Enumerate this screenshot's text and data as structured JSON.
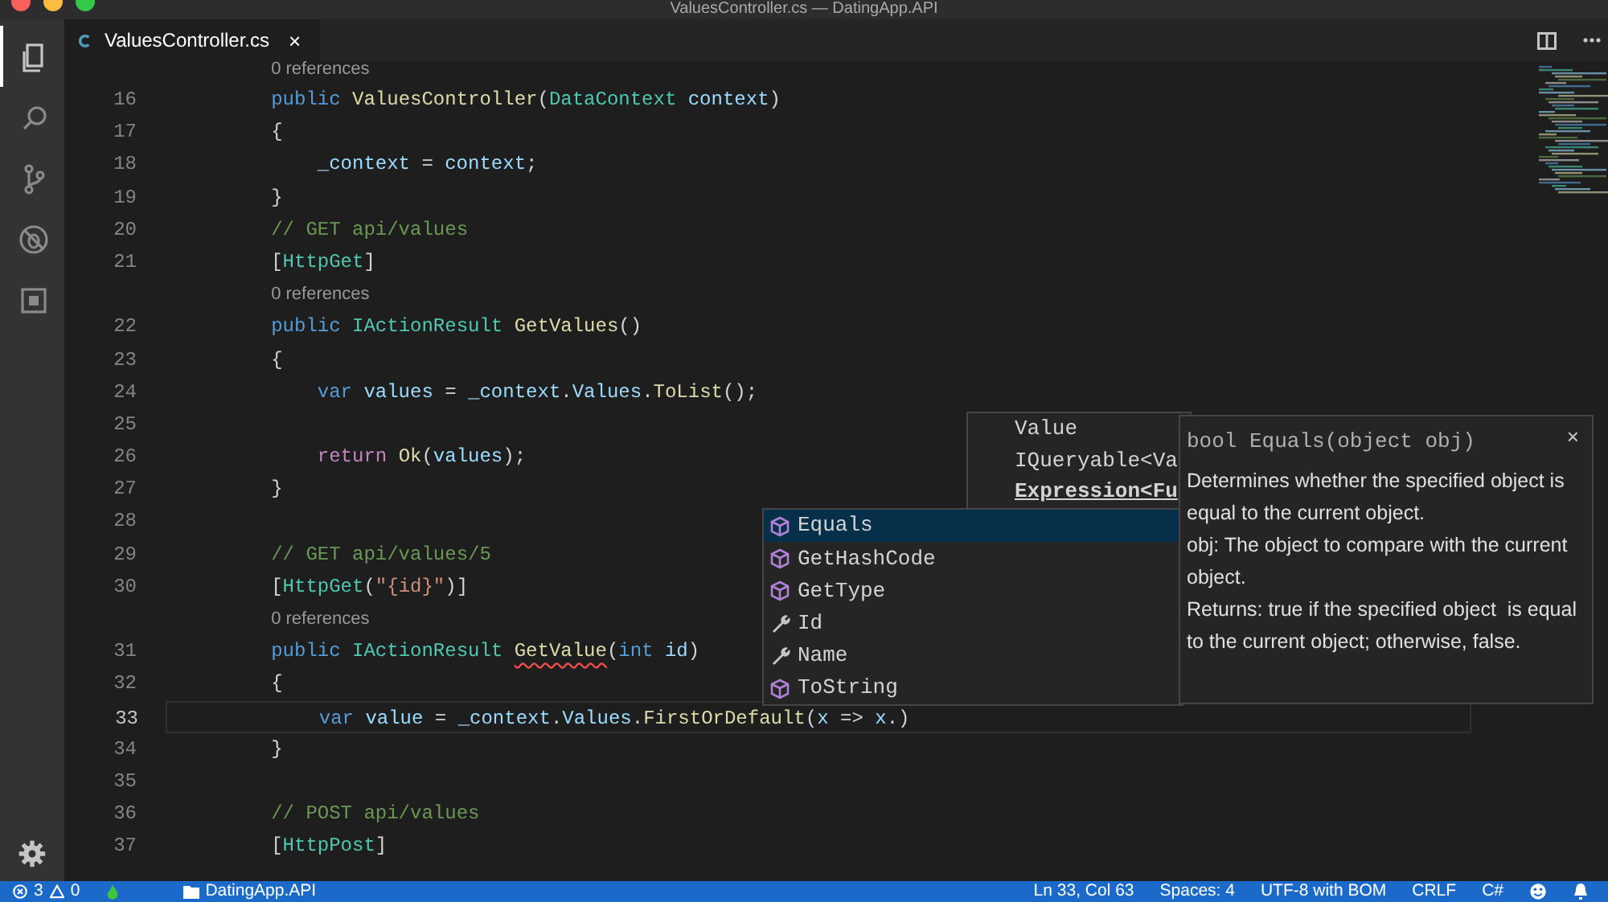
{
  "window": {
    "title": "ValuesController.cs — DatingApp.API"
  },
  "tabs": [
    {
      "label": "ValuesController.cs",
      "close": "×",
      "selected": true
    }
  ],
  "activity_bar": [
    {
      "kind": "files",
      "selected": true
    },
    {
      "kind": "search",
      "selected": false
    },
    {
      "kind": "scm",
      "selected": false
    },
    {
      "kind": "debug",
      "selected": false
    },
    {
      "kind": "extensions",
      "selected": false
    }
  ],
  "editor": {
    "lines": [
      {
        "kind": "lens",
        "text": "0 references"
      },
      {
        "kind": "code",
        "number": "16",
        "current": false,
        "indented": false,
        "tokens": [
          {
            "text": "public ",
            "kind": "kw"
          },
          {
            "text": "ValuesController",
            "kind": "fn"
          },
          {
            "text": "(",
            "kind": "plain"
          },
          {
            "text": "DataContext ",
            "kind": "type"
          },
          {
            "text": "context",
            "kind": "var"
          },
          {
            "text": ")",
            "kind": "plain"
          }
        ]
      },
      {
        "kind": "code",
        "number": "17",
        "current": false,
        "indented": false,
        "tokens": [
          {
            "text": "{",
            "kind": "plain"
          }
        ]
      },
      {
        "kind": "code",
        "number": "18",
        "current": false,
        "indented": true,
        "tokens": [
          {
            "text": "_context",
            "kind": "var"
          },
          {
            "text": " = ",
            "kind": "plain"
          },
          {
            "text": "context",
            "kind": "var"
          },
          {
            "text": ";",
            "kind": "plain"
          }
        ]
      },
      {
        "kind": "code",
        "number": "19",
        "current": false,
        "indented": false,
        "tokens": [
          {
            "text": "}",
            "kind": "plain"
          }
        ]
      },
      {
        "kind": "code",
        "number": "20",
        "current": false,
        "indented": false,
        "tokens": [
          {
            "text": "// GET api/values",
            "kind": "comment"
          }
        ]
      },
      {
        "kind": "code",
        "number": "21",
        "current": false,
        "indented": false,
        "tokens": [
          {
            "text": "[",
            "kind": "plain"
          },
          {
            "text": "HttpGet",
            "kind": "type"
          },
          {
            "text": "]",
            "kind": "plain"
          }
        ]
      },
      {
        "kind": "lens",
        "text": "0 references"
      },
      {
        "kind": "code",
        "number": "22",
        "current": false,
        "indented": false,
        "tokens": [
          {
            "text": "public ",
            "kind": "kw"
          },
          {
            "text": "IActionResult ",
            "kind": "type"
          },
          {
            "text": "GetValues",
            "kind": "fn"
          },
          {
            "text": "()",
            "kind": "plain"
          }
        ]
      },
      {
        "kind": "code",
        "number": "23",
        "current": false,
        "indented": false,
        "tokens": [
          {
            "text": "{",
            "kind": "plain"
          }
        ]
      },
      {
        "kind": "code",
        "number": "24",
        "current": false,
        "indented": true,
        "tokens": [
          {
            "text": "var ",
            "kind": "kw"
          },
          {
            "text": "values",
            "kind": "var"
          },
          {
            "text": " = ",
            "kind": "plain"
          },
          {
            "text": "_context",
            "kind": "var"
          },
          {
            "text": ".",
            "kind": "plain"
          },
          {
            "text": "Values",
            "kind": "var"
          },
          {
            "text": ".",
            "kind": "plain"
          },
          {
            "text": "ToList",
            "kind": "fn"
          },
          {
            "text": "();",
            "kind": "plain"
          }
        ]
      },
      {
        "kind": "code",
        "number": "25",
        "current": false
      },
      {
        "kind": "code",
        "number": "26",
        "current": false,
        "indented": true,
        "tokens": [
          {
            "text": "return ",
            "kind": "ctrl"
          },
          {
            "text": "Ok",
            "kind": "fn"
          },
          {
            "text": "(",
            "kind": "plain"
          },
          {
            "text": "values",
            "kind": "var"
          },
          {
            "text": ");",
            "kind": "plain"
          }
        ]
      },
      {
        "kind": "code",
        "number": "27",
        "current": false,
        "indented": false,
        "tokens": [
          {
            "text": "}",
            "kind": "plain"
          }
        ]
      },
      {
        "kind": "code",
        "number": "28",
        "current": false
      },
      {
        "kind": "code",
        "number": "29",
        "current": false,
        "indented": false,
        "tokens": [
          {
            "text": "// GET api/values/5",
            "kind": "comment"
          }
        ]
      },
      {
        "kind": "code",
        "number": "30",
        "current": false,
        "indented": false,
        "tokens": [
          {
            "text": "[",
            "kind": "plain"
          },
          {
            "text": "HttpGet",
            "kind": "type"
          },
          {
            "text": "(",
            "kind": "plain"
          },
          {
            "text": "\"{id}\"",
            "kind": "str"
          },
          {
            "text": ")]",
            "kind": "plain"
          }
        ]
      },
      {
        "kind": "lens",
        "text": "0 references"
      },
      {
        "kind": "code",
        "number": "31",
        "current": false,
        "indented": false,
        "tokens": [
          {
            "text": "public ",
            "kind": "kw"
          },
          {
            "text": "IActionResult ",
            "kind": "type"
          },
          {
            "text": "GetValue",
            "kind": "fn",
            "error": true
          },
          {
            "text": "(",
            "kind": "plain"
          },
          {
            "text": "int ",
            "kind": "kw"
          },
          {
            "text": "id",
            "kind": "var"
          },
          {
            "text": ")",
            "kind": "plain"
          }
        ]
      },
      {
        "kind": "code",
        "number": "32",
        "current": false,
        "indented": false,
        "tokens": [
          {
            "text": "{",
            "kind": "plain"
          }
        ]
      },
      {
        "kind": "code",
        "number": "33",
        "current": true,
        "indented": true,
        "tokens": [
          {
            "text": "var ",
            "kind": "kw"
          },
          {
            "text": "value",
            "kind": "var"
          },
          {
            "text": " = ",
            "kind": "plain"
          },
          {
            "text": "_context",
            "kind": "var"
          },
          {
            "text": ".",
            "kind": "plain"
          },
          {
            "text": "Values",
            "kind": "var"
          },
          {
            "text": ".",
            "kind": "plain"
          },
          {
            "text": "FirstOrDefault",
            "kind": "fn"
          },
          {
            "text": "(",
            "kind": "plain"
          },
          {
            "text": "x",
            "kind": "var"
          },
          {
            "text": " => ",
            "kind": "plain"
          },
          {
            "text": "x",
            "kind": "var"
          },
          {
            "text": ".",
            "kind": "plain"
          },
          {
            "text": ")",
            "kind": "plain"
          }
        ]
      },
      {
        "kind": "code",
        "number": "34",
        "current": false,
        "indented": false,
        "tokens": [
          {
            "text": "}",
            "kind": "plain"
          }
        ]
      },
      {
        "kind": "code",
        "number": "35",
        "current": false
      },
      {
        "kind": "code",
        "number": "36",
        "current": false,
        "indented": false,
        "tokens": [
          {
            "text": "// POST api/values",
            "kind": "comment"
          }
        ]
      },
      {
        "kind": "code",
        "number": "37",
        "current": false,
        "indented": false,
        "tokens": [
          {
            "text": "[",
            "kind": "plain"
          },
          {
            "text": "HttpPost",
            "kind": "type"
          },
          {
            "text": "]",
            "kind": "plain"
          }
        ]
      }
    ]
  },
  "parameter_hint": {
    "lines": [
      {
        "text": "Value",
        "active": false
      },
      {
        "text": "IQueryable<Va",
        "active": false
      },
      {
        "text": "Expression<Fu",
        "active": true
      }
    ]
  },
  "suggestions": [
    {
      "label": "Equals",
      "kind": "method",
      "selected": true
    },
    {
      "label": "GetHashCode",
      "kind": "method",
      "selected": false
    },
    {
      "label": "GetType",
      "kind": "method",
      "selected": false
    },
    {
      "label": "Id",
      "kind": "property",
      "selected": false
    },
    {
      "label": "Name",
      "kind": "property",
      "selected": false
    },
    {
      "label": "ToString",
      "kind": "method",
      "selected": false
    }
  ],
  "details": {
    "signature": "bool Equals(object obj)",
    "close": "×",
    "paragraphs": [
      "Determines whether the specified object is equal to the current object.",
      "obj: The object to compare with the current object.",
      "Returns: true if the specified object  is equal to the current object; otherwise, false."
    ]
  },
  "status_bar": {
    "errors": "3",
    "warnings": "0",
    "folder": "DatingApp.API",
    "right": [
      "Ln 33, Col 63",
      "Spaces: 4",
      "UTF-8 with BOM",
      "CRLF",
      "C#"
    ]
  }
}
